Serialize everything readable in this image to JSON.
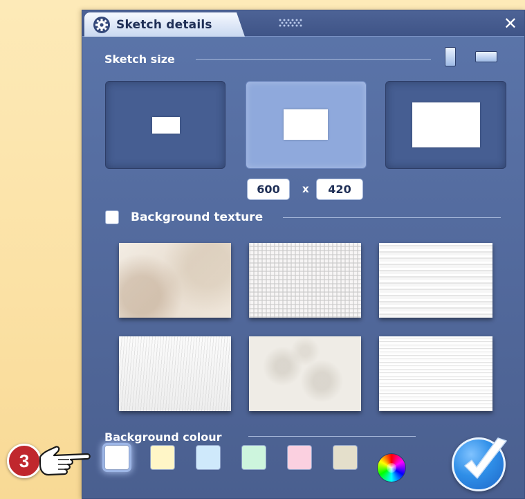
{
  "window": {
    "title": "Sketch details",
    "close_glyph": "✕"
  },
  "sketch_size": {
    "label": "Sketch size",
    "orientations": [
      "portrait-icon",
      "landscape-icon"
    ],
    "presets": [
      {
        "name": "small",
        "selected": false
      },
      {
        "name": "medium",
        "selected": true
      },
      {
        "name": "large",
        "selected": false
      }
    ],
    "width_value": "600",
    "separator": "x",
    "height_value": "420"
  },
  "background_texture": {
    "label": "Background texture",
    "checked": false,
    "textures": [
      "aged-paper",
      "canvas-weave",
      "brushed-white",
      "fibrous-paper",
      "crumpled-paper",
      "lined-white"
    ]
  },
  "background_colour": {
    "label": "Background colour",
    "swatches": [
      "#ffffff",
      "#fff6c7",
      "#cfe9fb",
      "#cdf5dd",
      "#fbd0e0",
      "#e4dfcb"
    ],
    "selected_index": 0,
    "custom": "colour-wheel-icon"
  },
  "step_callout": {
    "number": "3"
  },
  "colors": {
    "panel": "#52699c",
    "accent": "#2f8fe8",
    "badge": "#c0272d"
  }
}
